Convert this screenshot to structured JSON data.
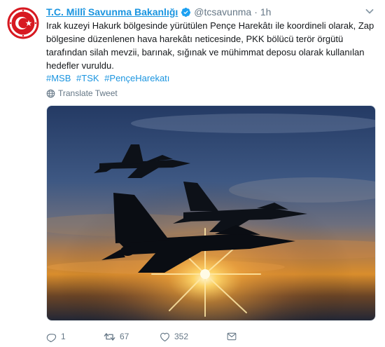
{
  "account": {
    "name": "T.C. Millî Savunma Bakanlığı",
    "handle": "@tcsavunma",
    "separator": "·",
    "time": "1h"
  },
  "tweet": {
    "lines": [
      "Irak kuzeyi Hakurk bölgesinde yürütülen Pençe Harekâtı ile koordineli olarak, Zap",
      "bölgesine düzenlenen hava harekâtı neticesinde, PKK bölücü terör örgütü",
      "tarafından silah mevzii, barınak, sığınak ve mühimmat deposu olarak kullanılan",
      "hedefler vuruldu."
    ],
    "hashtags": [
      "#MSB",
      "#TSK",
      "#PençeHarekatı"
    ],
    "translate_label": "Translate Tweet"
  },
  "actions": {
    "replies": "1",
    "retweets": "67",
    "likes": "352"
  },
  "colors": {
    "link": "#1b95e0",
    "muted": "#657786",
    "avatar_red": "#d71921"
  },
  "icons": [
    "msb-emblem-icon",
    "verified-badge-icon",
    "chevron-down-icon",
    "globe-icon",
    "reply-icon",
    "retweet-icon",
    "like-icon",
    "direct-message-icon"
  ]
}
